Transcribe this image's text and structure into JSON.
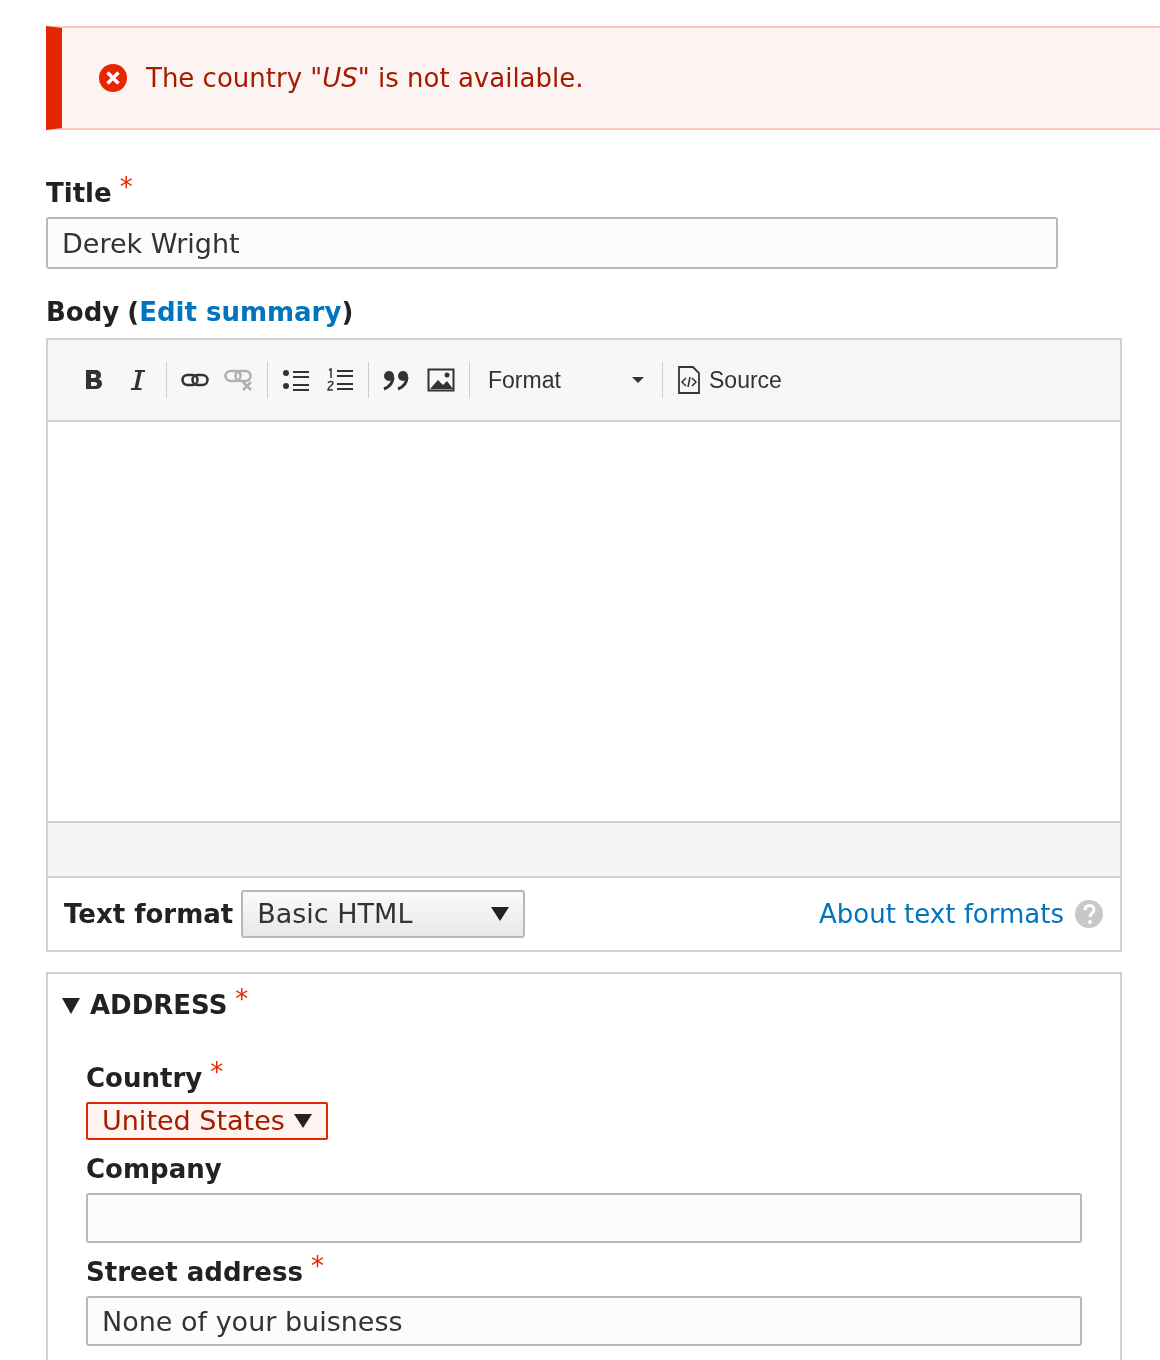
{
  "message": {
    "kind": "error",
    "text": "The country *\"US\"* is not available."
  },
  "title_field": {
    "label": "Title",
    "required_mark": "*",
    "value": "Derek Wright"
  },
  "body": {
    "label": "Body",
    "open": "(",
    "link": "Edit summary",
    "close": ")",
    "toolbar": [
      {
        "kind": "bold",
        "disabled": false
      },
      {
        "kind": "italic",
        "disabled": false
      },
      {
        "kind": "separator"
      },
      {
        "kind": "link",
        "disabled": false
      },
      {
        "kind": "unlink",
        "disabled": true
      },
      {
        "kind": "separator"
      },
      {
        "kind": "bulleted-list",
        "disabled": false
      },
      {
        "kind": "numbered-list",
        "disabled": false
      },
      {
        "kind": "separator"
      },
      {
        "kind": "quote",
        "disabled": false
      },
      {
        "kind": "image",
        "disabled": false
      },
      {
        "kind": "separator"
      },
      {
        "kind": "format",
        "label": "Format"
      },
      {
        "kind": "separator"
      },
      {
        "kind": "source",
        "label": "Source",
        "disabled": false
      }
    ],
    "text_format": {
      "label": "Text format",
      "value": "Basic HTML",
      "help_link": "About text formats"
    }
  },
  "address": {
    "legend": "ADDRESS",
    "required_mark": "*",
    "expanded": true,
    "fields": [
      {
        "kind": "select",
        "label": "Country",
        "required_mark": "*",
        "value": "United States",
        "error": true
      },
      {
        "kind": "text",
        "label": "Company"
      },
      {
        "kind": "text",
        "label": "Street address",
        "required_mark": "*",
        "value": "None of your buisness"
      }
    ]
  }
}
